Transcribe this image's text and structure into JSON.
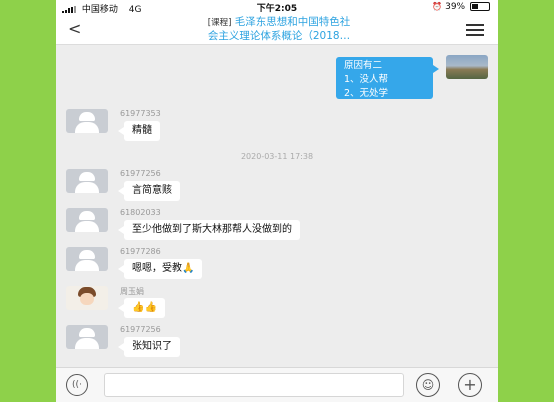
{
  "status_bar": {
    "carrier": "中国移动",
    "network": "4G",
    "time": "下午2:05",
    "battery_text": "39%",
    "battery_level": 0.39
  },
  "nav": {
    "back_icon": "chevron-left-icon",
    "tag": "[课程]",
    "title_line1": "毛泽东思想和中国特色社",
    "title_line2": "会主义理论体系概论（2018…",
    "menu_icon": "menu-icon"
  },
  "self_message": {
    "lines": [
      "原因有二",
      "1、没人帮",
      "2、无处学"
    ]
  },
  "messages": [
    {
      "sender": "61977353",
      "text": "精髓"
    },
    {
      "sender": "61977256",
      "text": "言简意赅"
    },
    {
      "sender": "61802033",
      "text": "至少他做到了斯大林那帮人没做到的"
    },
    {
      "sender": "61977286",
      "text": "嗯嗯，受教🙏"
    },
    {
      "sender": "周玉娟",
      "text": "👍👍"
    },
    {
      "sender": "61977256",
      "text": "张知识了"
    }
  ],
  "timestamp": "2020-03-11 17:38",
  "input_bar": {
    "voice_icon": "voice-icon",
    "emoji_icon": "emoji-icon",
    "plus_icon": "plus-icon"
  },
  "colors": {
    "accent": "#35a7ea",
    "background_frame": "#8ed14a",
    "chat_bg": "#ededed"
  }
}
